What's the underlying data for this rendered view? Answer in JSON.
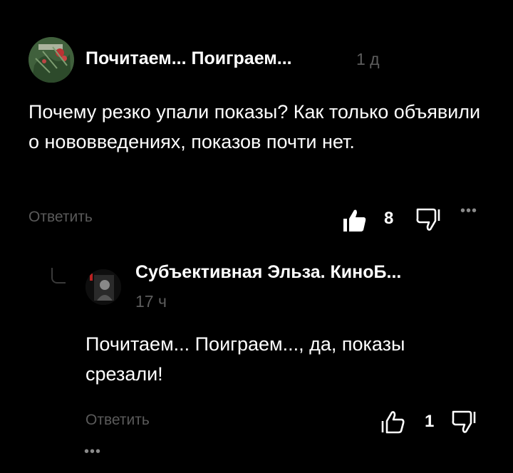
{
  "comment": {
    "author": "Почитаем... Поиграем...",
    "time": "1 д",
    "text": "Почему резко упали показы? Как только объявили о нововведениях, показов почти нет.",
    "reply_label": "Ответить",
    "likes": "8",
    "like_icon": "thumb-up-filled",
    "dislike_icon": "thumb-down-outline",
    "more": "•••"
  },
  "reply": {
    "author": "Субъективная Эльза. КиноБ...",
    "time": "17 ч",
    "text": "Почитаем... Поиграем..., да, показы срезали!",
    "reply_label": "Ответить",
    "likes": "1",
    "like_icon": "thumb-up-outline",
    "dislike_icon": "thumb-down-outline",
    "more": "•••"
  },
  "colors": {
    "background": "#000000",
    "text": "#ffffff",
    "muted": "#5a5a5a"
  }
}
